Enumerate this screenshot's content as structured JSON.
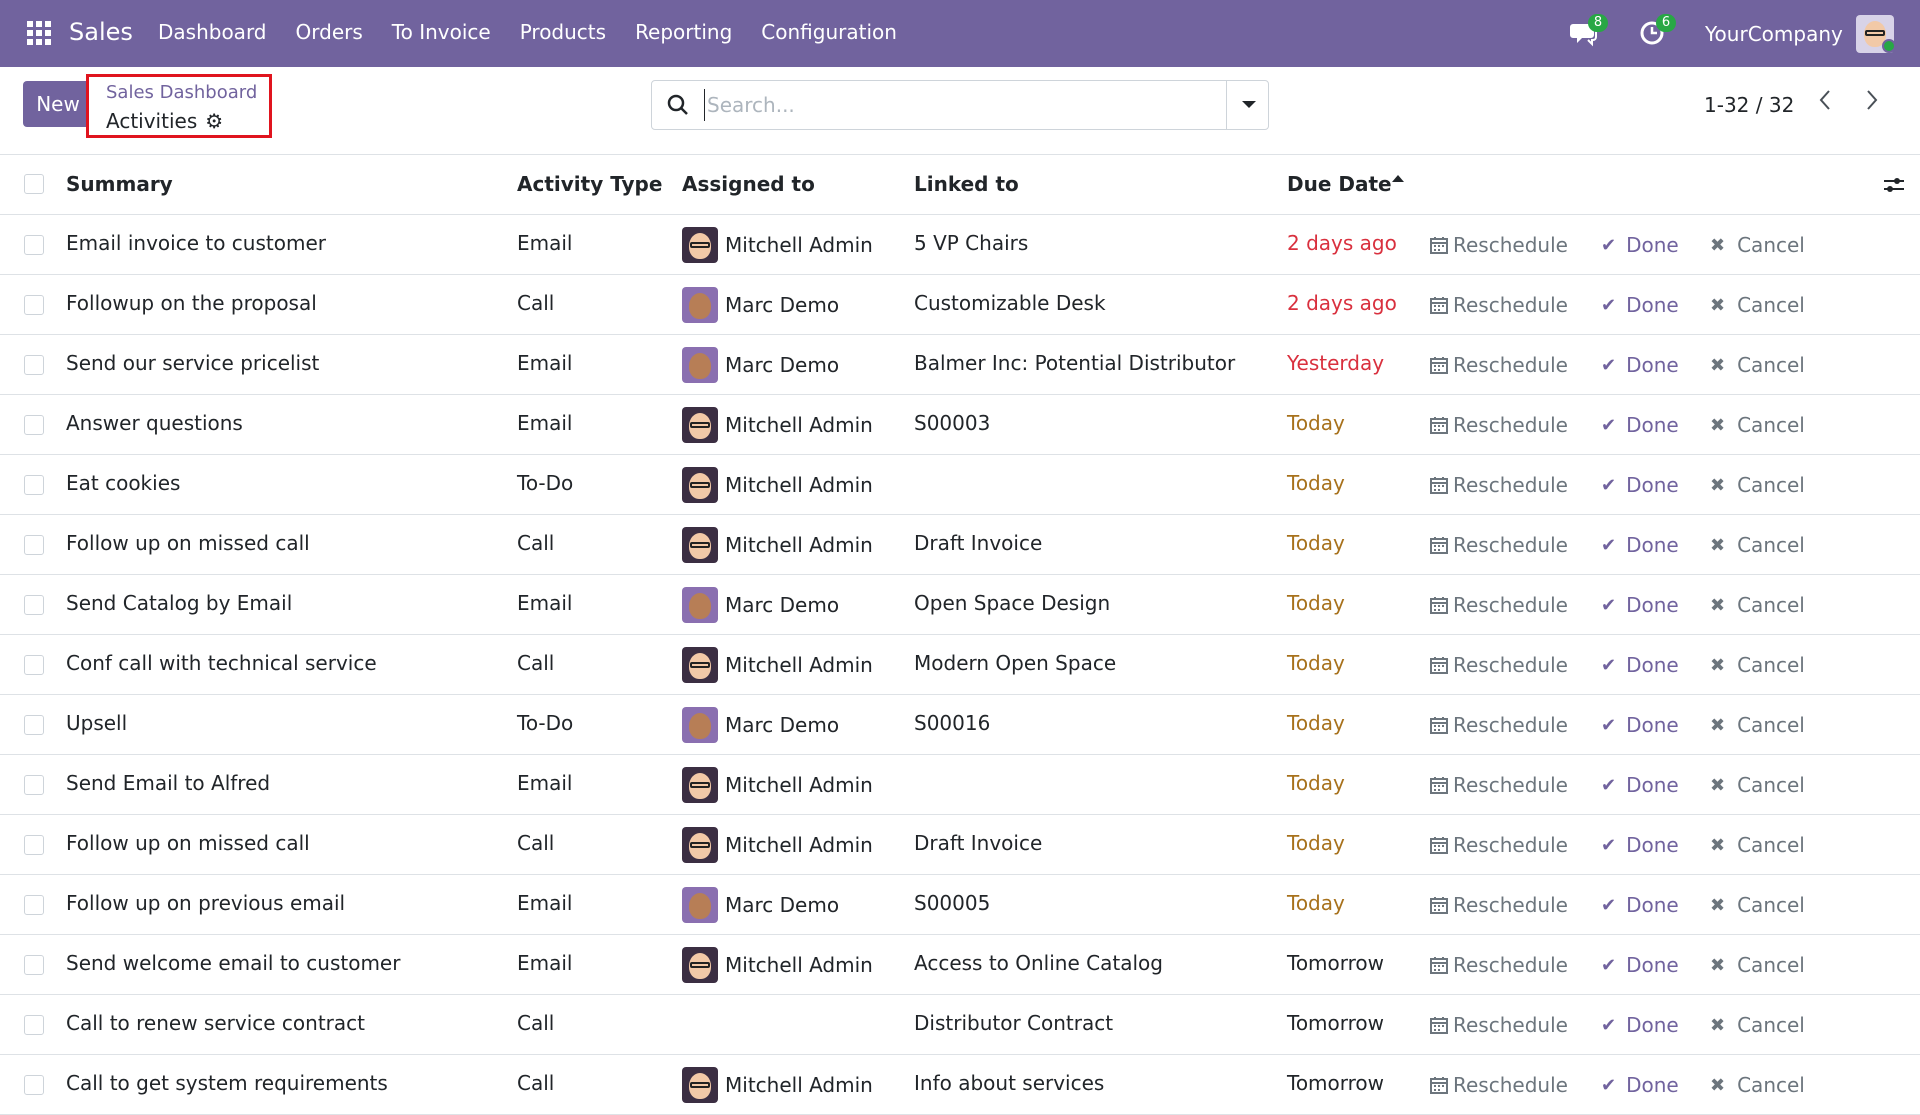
{
  "navbar": {
    "brand": "Sales",
    "menu": [
      "Dashboard",
      "Orders",
      "To Invoice",
      "Products",
      "Reporting",
      "Configuration"
    ],
    "messages_count": "8",
    "activities_count": "6",
    "company": "YourCompany",
    "accent_color": "#71639e"
  },
  "control": {
    "new_label": "New",
    "breadcrumb_parent": "Sales Dashboard",
    "breadcrumb_current": "Activities",
    "search_placeholder": "Search...",
    "pager": "1-32 / 32"
  },
  "table": {
    "headers": {
      "summary": "Summary",
      "activity_type": "Activity Type",
      "assigned_to": "Assigned to",
      "linked_to": "Linked to",
      "due_date": "Due Date"
    },
    "actions": {
      "reschedule": "Reschedule",
      "done": "Done",
      "cancel": "Cancel"
    },
    "rows": [
      {
        "summary": "Email invoice to customer",
        "type": "Email",
        "assigned": "Mitchell Admin",
        "avatar": "mitchell",
        "linked": "5 VP Chairs",
        "due": "2 days ago",
        "due_state": "overdue"
      },
      {
        "summary": "Followup on the proposal",
        "type": "Call",
        "assigned": "Marc Demo",
        "avatar": "marc",
        "linked": "Customizable Desk",
        "due": "2 days ago",
        "due_state": "overdue"
      },
      {
        "summary": "Send our service pricelist",
        "type": "Email",
        "assigned": "Marc Demo",
        "avatar": "marc",
        "linked": "Balmer Inc: Potential Distributor",
        "due": "Yesterday",
        "due_state": "overdue"
      },
      {
        "summary": "Answer questions",
        "type": "Email",
        "assigned": "Mitchell Admin",
        "avatar": "mitchell",
        "linked": "S00003",
        "due": "Today",
        "due_state": "today"
      },
      {
        "summary": "Eat cookies",
        "type": "To-Do",
        "assigned": "Mitchell Admin",
        "avatar": "mitchell",
        "linked": "",
        "due": "Today",
        "due_state": "today"
      },
      {
        "summary": "Follow up on missed call",
        "type": "Call",
        "assigned": "Mitchell Admin",
        "avatar": "mitchell",
        "linked": "Draft Invoice",
        "due": "Today",
        "due_state": "today"
      },
      {
        "summary": "Send Catalog by Email",
        "type": "Email",
        "assigned": "Marc Demo",
        "avatar": "marc",
        "linked": "Open Space Design",
        "due": "Today",
        "due_state": "today"
      },
      {
        "summary": "Conf call with technical service",
        "type": "Call",
        "assigned": "Mitchell Admin",
        "avatar": "mitchell",
        "linked": "Modern Open Space",
        "due": "Today",
        "due_state": "today"
      },
      {
        "summary": "Upsell",
        "type": "To-Do",
        "assigned": "Marc Demo",
        "avatar": "marc",
        "linked": "S00016",
        "due": "Today",
        "due_state": "today"
      },
      {
        "summary": "Send Email to Alfred",
        "type": "Email",
        "assigned": "Mitchell Admin",
        "avatar": "mitchell",
        "linked": "",
        "due": "Today",
        "due_state": "today"
      },
      {
        "summary": "Follow up on missed call",
        "type": "Call",
        "assigned": "Mitchell Admin",
        "avatar": "mitchell",
        "linked": "Draft Invoice",
        "due": "Today",
        "due_state": "today"
      },
      {
        "summary": "Follow up on previous email",
        "type": "Email",
        "assigned": "Marc Demo",
        "avatar": "marc",
        "linked": "S00005",
        "due": "Today",
        "due_state": "today"
      },
      {
        "summary": "Send welcome email to customer",
        "type": "Email",
        "assigned": "Mitchell Admin",
        "avatar": "mitchell",
        "linked": "Access to Online Catalog",
        "due": "Tomorrow",
        "due_state": "future"
      },
      {
        "summary": "Call to renew service contract",
        "type": "Call",
        "assigned": "",
        "avatar": "",
        "linked": "Distributor Contract",
        "due": "Tomorrow",
        "due_state": "future"
      },
      {
        "summary": "Call to get system requirements",
        "type": "Call",
        "assigned": "Mitchell Admin",
        "avatar": "mitchell",
        "linked": "Info about services",
        "due": "Tomorrow",
        "due_state": "future"
      }
    ]
  }
}
